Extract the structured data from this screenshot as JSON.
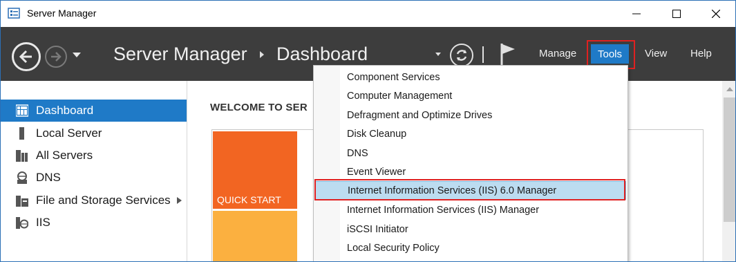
{
  "window": {
    "title": "Server Manager",
    "minimize_glyph": "—",
    "maximize_glyph": "☐",
    "close_glyph": "✕"
  },
  "header": {
    "breadcrumb_app": "Server Manager",
    "breadcrumb_page": "Dashboard",
    "menus": {
      "manage": "Manage",
      "tools": "Tools",
      "view": "View",
      "help": "Help"
    },
    "colors": {
      "background": "#3d3d3d",
      "accent": "#1f7ac7",
      "highlight_border": "#e02020"
    }
  },
  "sidebar": {
    "items": [
      {
        "label": "Dashboard",
        "icon": "dashboard-icon",
        "active": true
      },
      {
        "label": "Local Server",
        "icon": "local-server-icon",
        "active": false
      },
      {
        "label": "All Servers",
        "icon": "all-servers-icon",
        "active": false
      },
      {
        "label": "DNS",
        "icon": "dns-icon",
        "active": false
      },
      {
        "label": "File and Storage Services",
        "icon": "file-storage-icon",
        "active": false,
        "has_submenu": true
      },
      {
        "label": "IIS",
        "icon": "iis-icon",
        "active": false
      }
    ]
  },
  "main": {
    "welcome": "WELCOME TO SER",
    "quick_start": "QUICK START",
    "colors": {
      "quick_start": "#f26522",
      "secondary_tile": "#fbb040"
    }
  },
  "tools_menu": {
    "items": [
      {
        "label": "Component Services"
      },
      {
        "label": "Computer Management"
      },
      {
        "label": "Defragment and Optimize Drives"
      },
      {
        "label": "Disk Cleanup"
      },
      {
        "label": "DNS"
      },
      {
        "label": "Event Viewer"
      },
      {
        "label": "Internet Information Services (IIS) 6.0 Manager",
        "highlighted": true
      },
      {
        "label": "Internet Information Services (IIS) Manager"
      },
      {
        "label": "iSCSI Initiator"
      },
      {
        "label": "Local Security Policy"
      }
    ]
  }
}
